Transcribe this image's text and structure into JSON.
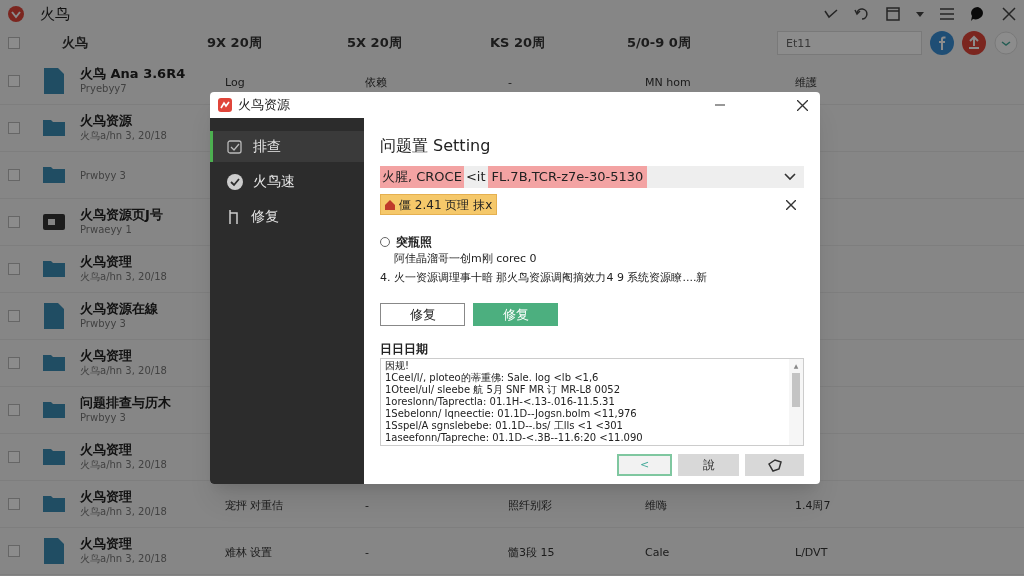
{
  "app": {
    "title": "火鸟",
    "search": {
      "placeholder": "Et11"
    }
  },
  "table": {
    "columns": [
      "火鸟",
      "9X 20周",
      "5X 20周",
      "KS 20周",
      "5/0-9 0周"
    ],
    "all_checked": false,
    "rows": [
      {
        "kind": "file",
        "checked": false,
        "name": "火鸟 Ana 3.6R4",
        "sub": "Pryebyy7",
        "cells": [
          "Log",
          "依赖",
          "-",
          "MN hom",
          "维護"
        ]
      },
      {
        "kind": "folder",
        "checked": false,
        "name": "火鸟资源",
        "sub": "火鸟a/hn 3, 20/18"
      },
      {
        "kind": "folder",
        "checked": false,
        "sub": "Prwbyy 3"
      },
      {
        "kind": "dark",
        "checked": false,
        "name": "火鸟资源页J号",
        "sub": "Prwaeyy 1"
      },
      {
        "kind": "folder",
        "checked": false,
        "name": "火鸟资理",
        "sub": "火鸟a/hn 3, 20/18"
      },
      {
        "kind": "file",
        "checked": false,
        "name": "火鸟资源在線",
        "sub": "Prwbyy 3"
      },
      {
        "kind": "folder",
        "checked": false,
        "name": "火鸟资理",
        "sub": "火鸟a/hn 3, 20/18"
      },
      {
        "kind": "folder",
        "checked": false,
        "name": "问题排查与历木",
        "sub": "Prwbyy 3"
      },
      {
        "kind": "folder",
        "checked": false,
        "name": "火鸟资理",
        "sub": "火鸟a/hn 3, 20/18"
      },
      {
        "kind": "folder",
        "checked": false,
        "name": "火鸟资理",
        "sub": "火鸟a/hn 3, 20/18",
        "cells": [
          "宠抨 对重佶",
          "-",
          "照纤别彩",
          "维嗨",
          "1.4周7"
        ]
      },
      {
        "kind": "file",
        "checked": false,
        "name": "火鸟资理",
        "sub": "火鸟a/hn 3, 20/18",
        "cells": [
          "难林 设置",
          "-",
          "髓3段 15",
          "Cale",
          "L/DVT"
        ]
      }
    ]
  },
  "dialog": {
    "title": "火鸟资源",
    "nav": [
      {
        "label": "排查",
        "kind": "checklist",
        "selected": true
      },
      {
        "label": "火鸟速",
        "kind": "check",
        "selected": false
      },
      {
        "label": "修复",
        "kind": "repair",
        "selected": false
      }
    ],
    "heading": "问题置 Setting",
    "select": {
      "parts": [
        "火腥, CROCE",
        "<it",
        "FL.7B,TCR-z7e-30-5130"
      ]
    },
    "badge": "僵 2.41 页理 抹x",
    "option": {
      "label": "突瓶照",
      "selected": false,
      "desc": "阿佳晶溜哥一创m刚 corec 0"
    },
    "note": "4. 火一资源调理事十暗 那火鸟资源调阉摘效力4 9 系统资源瞭....新",
    "buttons": [
      {
        "label": "修复",
        "kind": "outline"
      },
      {
        "label": "修复",
        "kind": "primary"
      }
    ],
    "log": {
      "label": "日日日期",
      "scroll_up": "▲",
      "lines": [
        "因规!",
        "1Ceel/l/, ploteo的蒂重佛: Sale. log <lb <1,6",
        "1Oteel/ul/ sleebe 航 5月 SNF MR 订 MR-L8 0052",
        "1oreslonn/Taprectla: 01.1H-<.13-.016-11.5.31",
        "1Sebelonn/ Iqneectie: 01.1D--Jogsn.bolm <11,976",
        "1Sspel/A sgnslebebe: 01.1D--.bs/ 工lls <1 <301",
        "1aseefonn/Tapreche: 01.1D-<.3B--11.6:20 <11.090"
      ]
    },
    "footer": [
      {
        "kind": "back",
        "label": "<"
      },
      {
        "kind": "text",
        "label": "說"
      },
      {
        "kind": "shield"
      }
    ]
  }
}
